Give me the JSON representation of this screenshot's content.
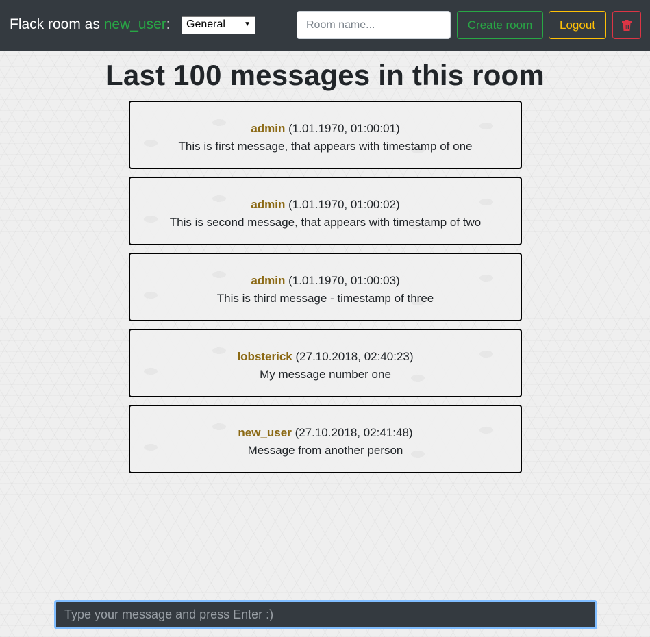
{
  "navbar": {
    "brand_prefix": "Flack room as ",
    "username": "new_user",
    "brand_suffix": ":",
    "room_select_value": "General",
    "room_input_placeholder": "Room name...",
    "create_room_label": "Create room",
    "logout_label": "Logout",
    "delete_icon": "trash-icon"
  },
  "heading": "Last 100 messages in this room",
  "messages": [
    {
      "author": "admin",
      "timestamp": "(1.01.1970, 01:00:01)",
      "text": "This is first message, that appears with timestamp of one"
    },
    {
      "author": "admin",
      "timestamp": "(1.01.1970, 01:00:02)",
      "text": "This is second message, that appears with timestamp of two"
    },
    {
      "author": "admin",
      "timestamp": "(1.01.1970, 01:00:03)",
      "text": "This is third message - timestamp of three"
    },
    {
      "author": "lobsterick",
      "timestamp": "(27.10.2018, 02:40:23)",
      "text": "My message number one"
    },
    {
      "author": "new_user",
      "timestamp": "(27.10.2018, 02:41:48)",
      "text": "Message from another person"
    }
  ],
  "composer": {
    "placeholder": "Type your message and press Enter :)"
  },
  "colors": {
    "navbar_bg": "#343a40",
    "username": "#28a745",
    "create_room": "#28a745",
    "logout": "#ffc107",
    "delete": "#dc3545",
    "author": "#8b6914",
    "composer_focus": "#80bdff"
  }
}
